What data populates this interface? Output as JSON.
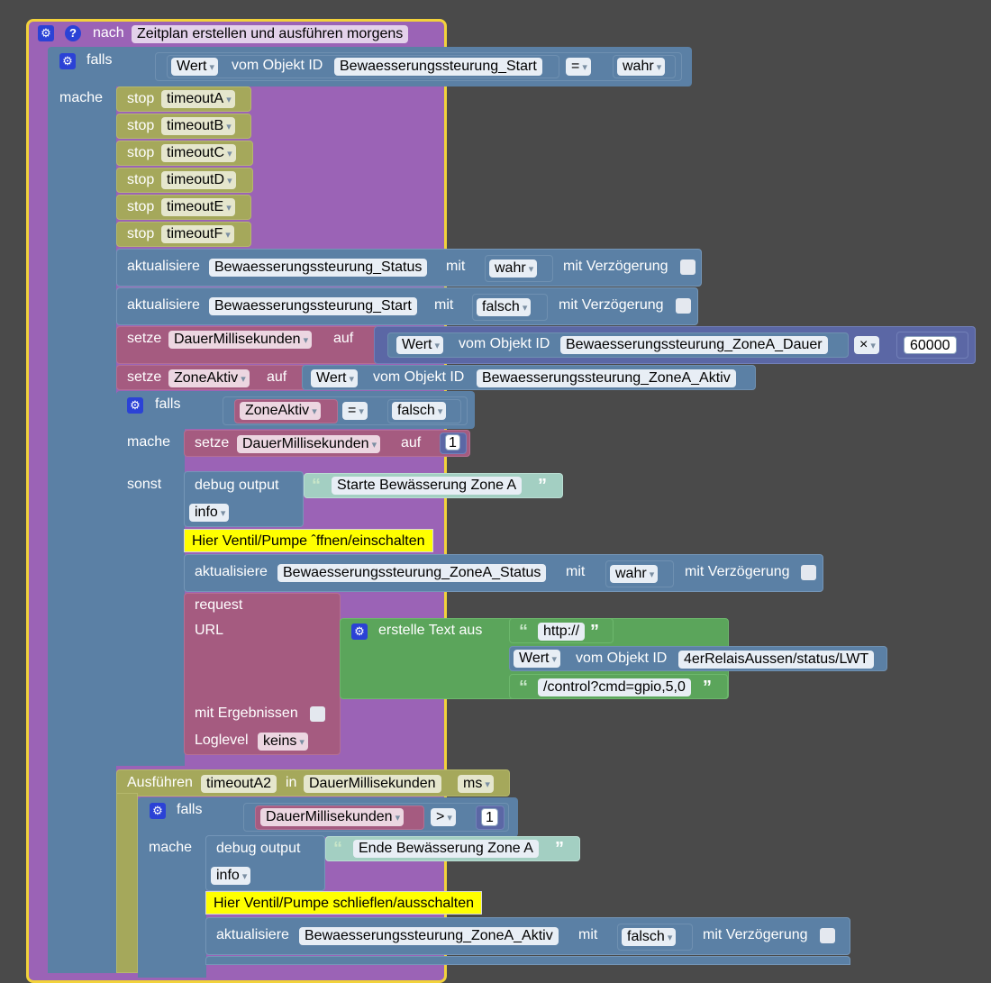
{
  "header": {
    "label": "nach",
    "name": "Zeitplan erstellen und ausführen morgens"
  },
  "if1": {
    "falls": "falls",
    "mache": "mache",
    "field": "Wert",
    "obj_text": "vom Objekt ID",
    "obj": "Bewaesserungssteurung_Start",
    "op": "=",
    "val": "wahr"
  },
  "stops": [
    {
      "label": "stop",
      "var": "timeoutA"
    },
    {
      "label": "stop",
      "var": "timeoutB"
    },
    {
      "label": "stop",
      "var": "timeoutC"
    },
    {
      "label": "stop",
      "var": "timeoutD"
    },
    {
      "label": "stop",
      "var": "timeoutE"
    },
    {
      "label": "stop",
      "var": "timeoutF"
    }
  ],
  "upd1": {
    "label": "aktualisiere",
    "obj": "Bewaesserungssteurung_Status",
    "mit": "mit",
    "val": "wahr",
    "delay": "mit Verzögerung"
  },
  "upd2": {
    "label": "aktualisiere",
    "obj": "Bewaesserungssteurung_Start",
    "mit": "mit",
    "val": "falsch",
    "delay": "mit Verzögerung"
  },
  "set1": {
    "label": "setze",
    "var": "DauerMillisekunden",
    "auf": "auf",
    "field": "Wert",
    "obj_text": "vom Objekt ID",
    "obj": "Bewaesserungssteurung_ZoneA_Dauer",
    "op": "×",
    "num": "60000"
  },
  "set2": {
    "label": "setze",
    "var": "ZoneAktiv",
    "auf": "auf",
    "field": "Wert",
    "obj_text": "vom Objekt ID",
    "obj": "Bewaesserungssteurung_ZoneA_Aktiv"
  },
  "if2": {
    "falls": "falls",
    "mache": "mache",
    "sonst": "sonst",
    "var": "ZoneAktiv",
    "op": "=",
    "val": "falsch",
    "set_label": "setze",
    "set_var": "DauerMillisekunden",
    "set_auf": "auf",
    "set_num": "1"
  },
  "debug1": {
    "label": "debug output",
    "text": "Starte Bewässerung Zone A",
    "level": "info"
  },
  "note1": "Hier Ventil/Pumpe ˆffnen/einschalten",
  "upd3": {
    "label": "aktualisiere",
    "obj": "Bewaesserungssteurung_ZoneA_Status",
    "mit": "mit",
    "val": "wahr",
    "delay": "mit Verzögerung"
  },
  "request": {
    "label": "request",
    "url": "URL",
    "create": "erstelle Text aus",
    "t1": "http://",
    "field": "Wert",
    "obj_text": "vom Objekt ID",
    "obj": "4erRelaisAussen/status/LWT",
    "t2": "/control?cmd=gpio,5,0",
    "results": "mit Ergebnissen",
    "loglevel": "Loglevel",
    "loglevel_val": "keins"
  },
  "exec": {
    "label": "Ausführen",
    "var": "timeoutA2",
    "in": "in",
    "dur": "DauerMillisekunden",
    "unit": "ms"
  },
  "if3": {
    "falls": "falls",
    "mache": "mache",
    "var": "DauerMillisekunden",
    "op": ">",
    "num": "1"
  },
  "debug2": {
    "label": "debug output",
    "text": "Ende Bewässerung Zone A",
    "level": "info"
  },
  "note2": "Hier Ventil/Pumpe schlieflen/ausschalten",
  "upd4": {
    "label": "aktualisiere",
    "obj": "Bewaesserungssteurung_ZoneA_Aktiv",
    "mit": "mit",
    "val": "falsch",
    "delay": "mit Verzögerung"
  }
}
